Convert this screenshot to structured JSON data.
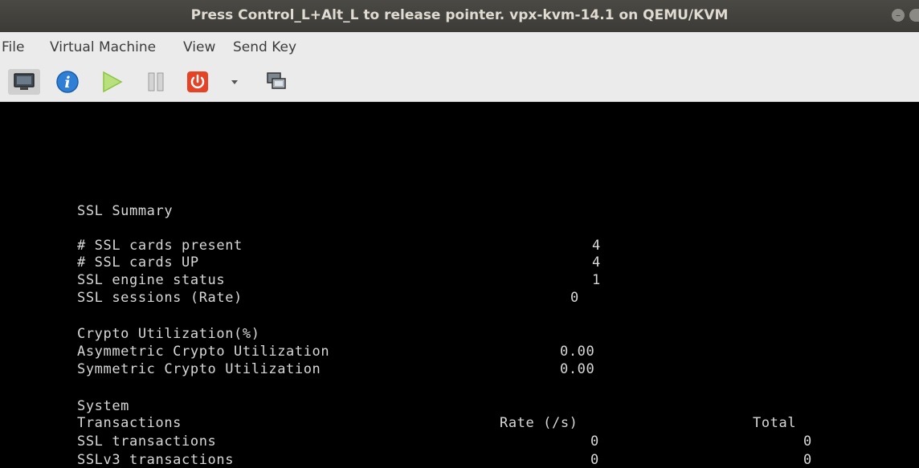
{
  "window": {
    "title": "Press Control_L+Alt_L to release pointer. vpx-kvm-14.1 on QEMU/KVM"
  },
  "menu": [
    "File",
    "Virtual Machine",
    "View",
    "Send Key"
  ],
  "toolbar": {
    "icons": [
      "monitor-icon",
      "info-icon",
      "play-icon",
      "pause-icon",
      "power-icon",
      "dropdown-arrow-icon",
      "screens-icon"
    ],
    "colors": {
      "info": "#2f7fd6",
      "play": "#9ad14b",
      "power": "#e64225"
    }
  },
  "console": {
    "heading": "SSL Summary",
    "cards_present_label": "# SSL cards present",
    "cards_present_value": "4",
    "cards_up_label": "# SSL cards UP",
    "cards_up_value": "4",
    "engine_status_label": "SSL engine status",
    "engine_status_value": "1",
    "sessions_label": "SSL sessions (Rate)",
    "sessions_value": "0",
    "crypto_heading": "Crypto Utilization(%)",
    "asym_label": "Asymmetric Crypto Utilization",
    "asym_value": "0.00",
    "sym_label": "Symmetric Crypto Utilization",
    "sym_value": "0.00",
    "system_heading": "System",
    "trans_col": "Transactions",
    "rate_col": "Rate (/s)",
    "total_col": "Total",
    "ssl_trans_label": "SSL transactions",
    "ssl_trans_rate": "0",
    "ssl_trans_total": "0",
    "sslv3_label": "SSLv3 transactions",
    "sslv3_rate": "0",
    "sslv3_total": "0"
  }
}
